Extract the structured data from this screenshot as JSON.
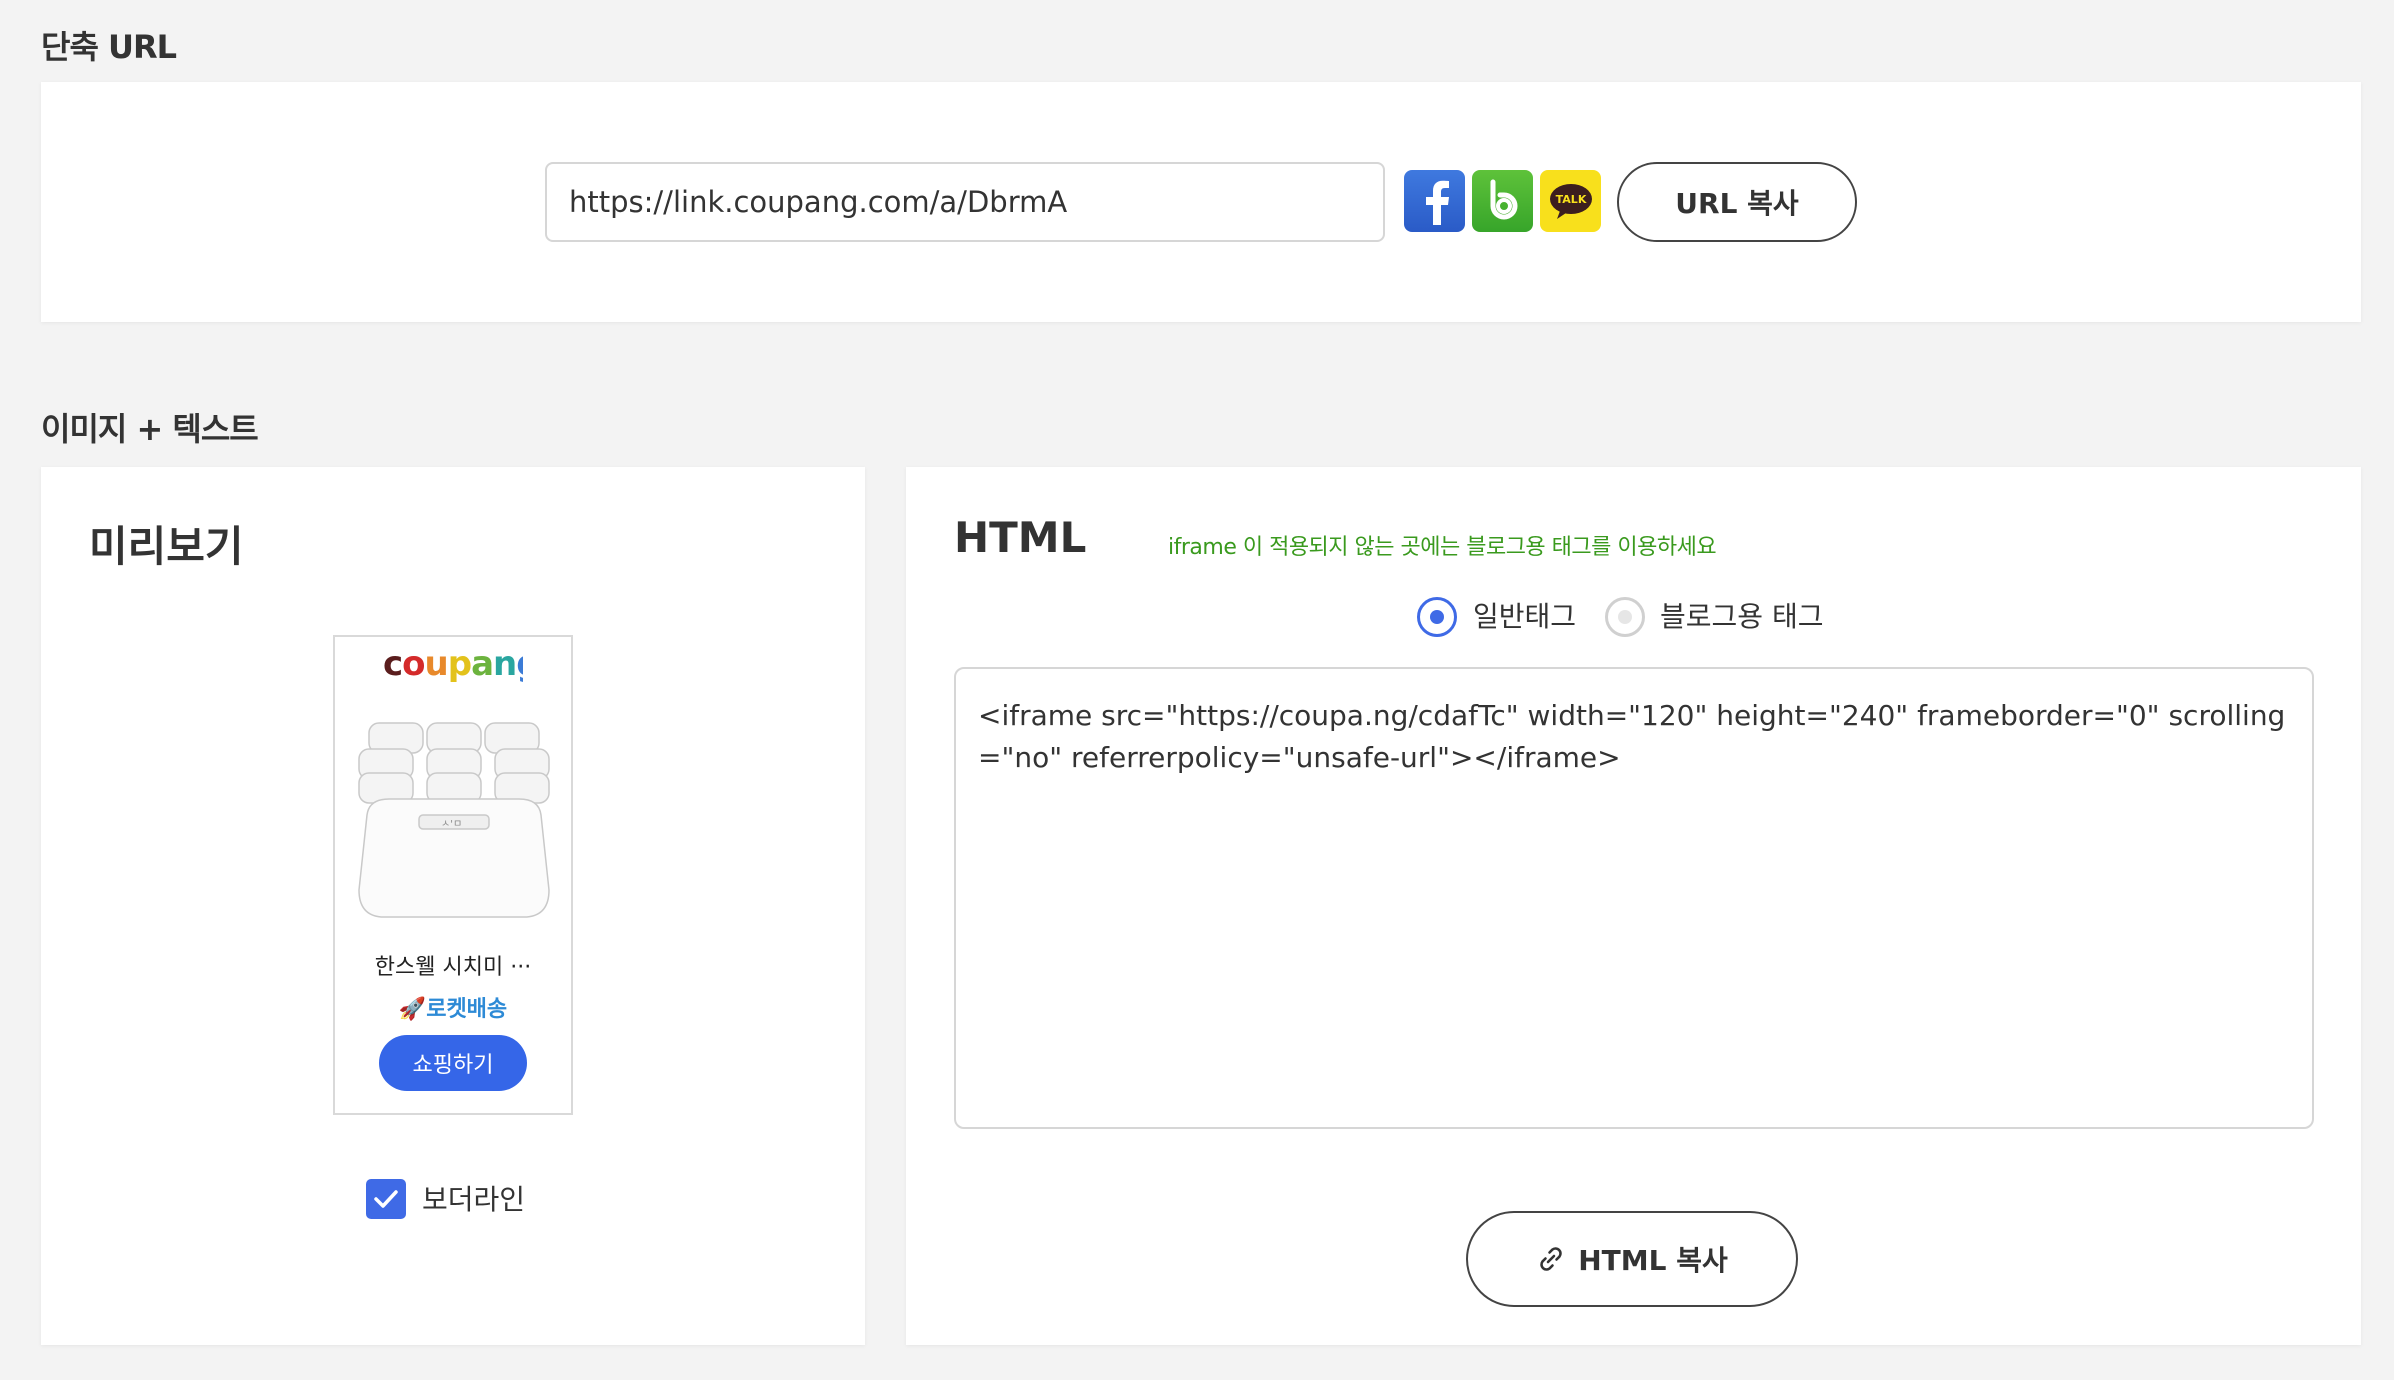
{
  "short_url": {
    "title": "단축 URL",
    "url_value": "https://link.coupang.com/a/DbrmA",
    "share_icons": [
      "facebook-icon",
      "band-icon",
      "kakaotalk-icon"
    ],
    "kakao_icon_text": "TALK",
    "copy_label": "URL 복사"
  },
  "image_text": {
    "title": "이미지 + 텍스트",
    "preview": {
      "heading": "미리보기",
      "logo": "coupang",
      "product_name": "한스웰 시치미 ···",
      "rocket_label": "🚀로켓배송",
      "shop_button": "쇼핑하기",
      "border_checkbox_label": "보더라인",
      "border_checked": true
    },
    "html": {
      "heading": "HTML",
      "notice": "iframe 이 적용되지 않는 곳에는 블로그용 태그를 이용하세요",
      "radio_options": [
        {
          "label": "일반태그",
          "selected": true
        },
        {
          "label": "블로그용 태그",
          "selected": false
        }
      ],
      "code": "<iframe src=\"https://coupa.ng/cdafTc\" width=\"120\" height=\"240\" frameborder=\"0\" scrolling=\"no\" referrerpolicy=\"unsafe-url\"></iframe>",
      "copy_label": "HTML 복사"
    }
  },
  "colors": {
    "accent": "#3f6ae6",
    "notice_green": "#3a9a1e",
    "facebook": "#3b5aa9",
    "band": "#4cb531",
    "kakao": "#f8e01c"
  }
}
